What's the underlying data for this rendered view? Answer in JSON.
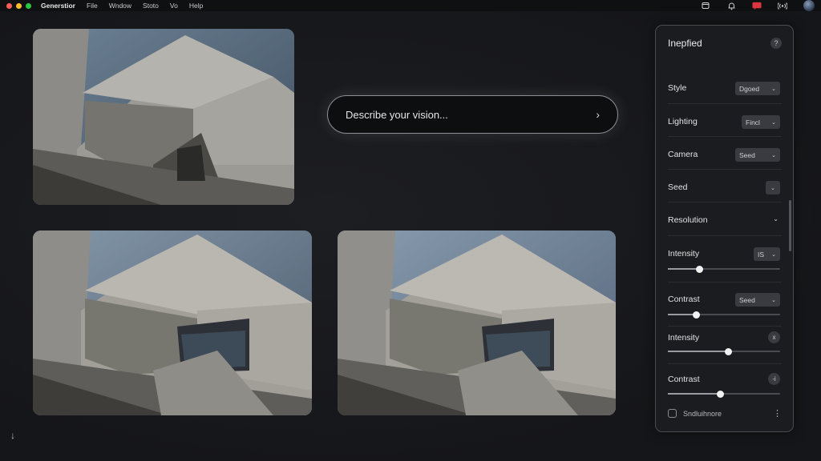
{
  "menubar": {
    "app_name": "Generstior",
    "menus": [
      "File",
      "Wndow",
      "Stoto",
      "Vo",
      "Help"
    ],
    "notification_badge": "!!"
  },
  "prompt": {
    "placeholder": "Describe your vision...",
    "submit_icon": "chevron-right-icon"
  },
  "images": [
    {
      "name": "generated-image-1",
      "subject": "brutalist concrete building"
    },
    {
      "name": "generated-image-2",
      "subject": "brutalist concrete building"
    },
    {
      "name": "generated-image-3",
      "subject": "brutalist concrete building"
    }
  ],
  "panel": {
    "title": "Inepfied",
    "help": "?",
    "rows": {
      "style": {
        "label": "Style",
        "value": "Dgoed"
      },
      "lighting": {
        "label": "Lighting",
        "value": "Fincl"
      },
      "camera": {
        "label": "Camera",
        "value": "Seed"
      },
      "seed": {
        "label": "Seed"
      },
      "resolution": {
        "label": "Resolution"
      },
      "intensity1": {
        "label": "Intensity",
        "value": "IS",
        "slider": 0.28
      },
      "contrast1": {
        "label": "Contrast",
        "value": "Seed",
        "slider": 0.25
      },
      "intensity2": {
        "label": "Intensity",
        "button": "x",
        "slider": 0.54
      },
      "contrast2": {
        "label": "Contrast",
        "button": "-i",
        "slider": 0.47
      }
    },
    "footer_label": "Sndluihnore",
    "footer_more": "⋮"
  },
  "colors": {
    "accent": "#f2f2f4",
    "background": "#18191c",
    "panel": "#1b1c1f"
  }
}
